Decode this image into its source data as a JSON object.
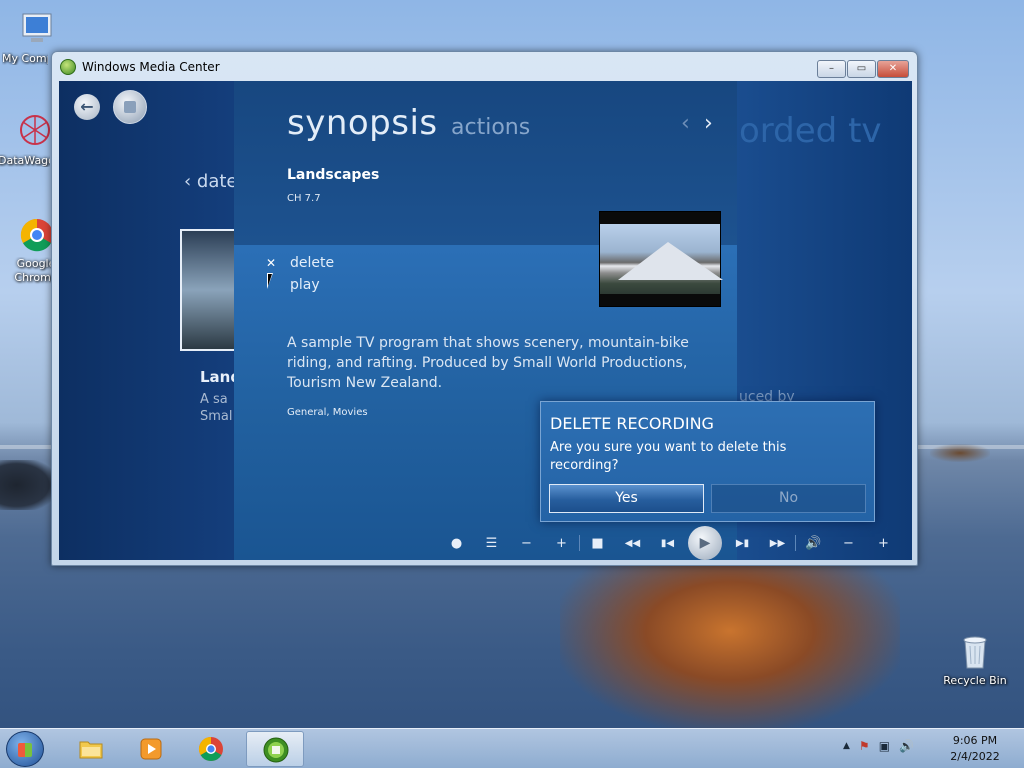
{
  "desktop": {
    "icons": [
      {
        "label": "My Computer",
        "icon": "computer-icon"
      },
      {
        "label": "DataWagon",
        "icon": "datawagon-icon"
      },
      {
        "label": "Google Chrome",
        "icon": "chrome-icon"
      },
      {
        "label": "Recycle Bin",
        "icon": "recycle-bin-icon"
      }
    ]
  },
  "window": {
    "title": "Windows Media Center",
    "buttons": {
      "minimize": "–",
      "maximize": "▭",
      "close": "✕"
    }
  },
  "media_center": {
    "background": {
      "date_link": "‹ date",
      "heading": "orded tv",
      "program_title": "Land",
      "program_sub": "A sa\nSmal",
      "produced_by": "uced by"
    },
    "tabs": {
      "synopsis": "synopsis",
      "actions": "actions"
    },
    "nav": {
      "prev": "‹",
      "next": "›"
    },
    "program": {
      "title": "Landscapes",
      "channel": "CH 7.7",
      "description": "A sample TV program that shows scenery, mountain-bike riding, and rafting. Produced by Small World Productions, Tourism New Zealand.",
      "genres": "General, Movies"
    },
    "actions": [
      {
        "label": "delete"
      },
      {
        "label": "play"
      }
    ],
    "dialog": {
      "title": "DELETE RECORDING",
      "message": "Are you sure you want to delete this recording?",
      "yes": "Yes",
      "no": "No"
    },
    "transport": {
      "record": "●",
      "guide": "☰",
      "ch_down": "−",
      "ch_up": "+",
      "stop": "■",
      "rewind": "◀◀",
      "prev": "▮◀",
      "play": "▶",
      "next": "▶▮",
      "ffwd": "▶▶",
      "volume": "🔊",
      "vol_down": "−",
      "vol_up": "+"
    }
  },
  "taskbar": {
    "items": [
      {
        "name": "explorer",
        "icon": "folder-icon"
      },
      {
        "name": "media-player",
        "icon": "media-player-icon"
      },
      {
        "name": "chrome",
        "icon": "chrome-icon"
      },
      {
        "name": "media-center",
        "icon": "media-center-icon"
      }
    ],
    "tray": {
      "up_arrow": "▲",
      "flag": "⚑",
      "network": "▣",
      "volume": "🔊"
    },
    "clock": {
      "time": "9:06 PM",
      "date": "2/4/2022"
    }
  },
  "colors": {
    "mc_blue": "#2b6fb6",
    "dialog_blue": "#2463a6",
    "close_red": "#c64d3a"
  }
}
